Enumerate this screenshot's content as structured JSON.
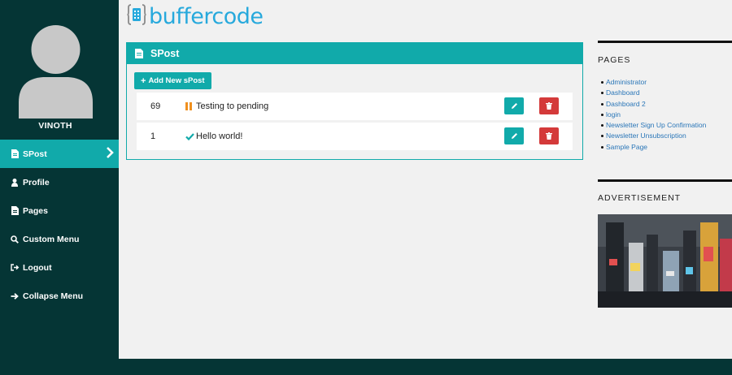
{
  "brand": {
    "name": "buffercode",
    "color": "#27a9dc"
  },
  "user": {
    "name": "VINOTH"
  },
  "sidebar": {
    "items": [
      {
        "label": "SPost",
        "icon": "document-icon",
        "active": true
      },
      {
        "label": "Profile",
        "icon": "user-icon"
      },
      {
        "label": "Pages",
        "icon": "document-icon"
      },
      {
        "label": "Custom Menu",
        "icon": "search-icon"
      },
      {
        "label": "Logout",
        "icon": "logout-icon"
      },
      {
        "label": "Collapse Menu",
        "icon": "arrow-right-icon"
      }
    ]
  },
  "panel": {
    "title": "SPost",
    "add_button": "Add New sPost",
    "rows": [
      {
        "id": "69",
        "status": "pending",
        "title": "Testing to pending"
      },
      {
        "id": "1",
        "status": "published",
        "title": "Hello world!"
      }
    ]
  },
  "widgets": {
    "pages": {
      "title": "PAGES",
      "items": [
        "Administrator",
        "Dashboard",
        "Dashboard 2",
        "login",
        "Newsletter Sign Up Confirmation",
        "Newsletter Unsubscription",
        "Sample Page"
      ]
    },
    "ad": {
      "title": "ADVERTISEMENT"
    }
  },
  "colors": {
    "sidebar_bg": "#053535",
    "accent": "#11aaaa",
    "danger": "#d43a3a",
    "pending": "#f0901e",
    "link": "#2a76b8"
  }
}
